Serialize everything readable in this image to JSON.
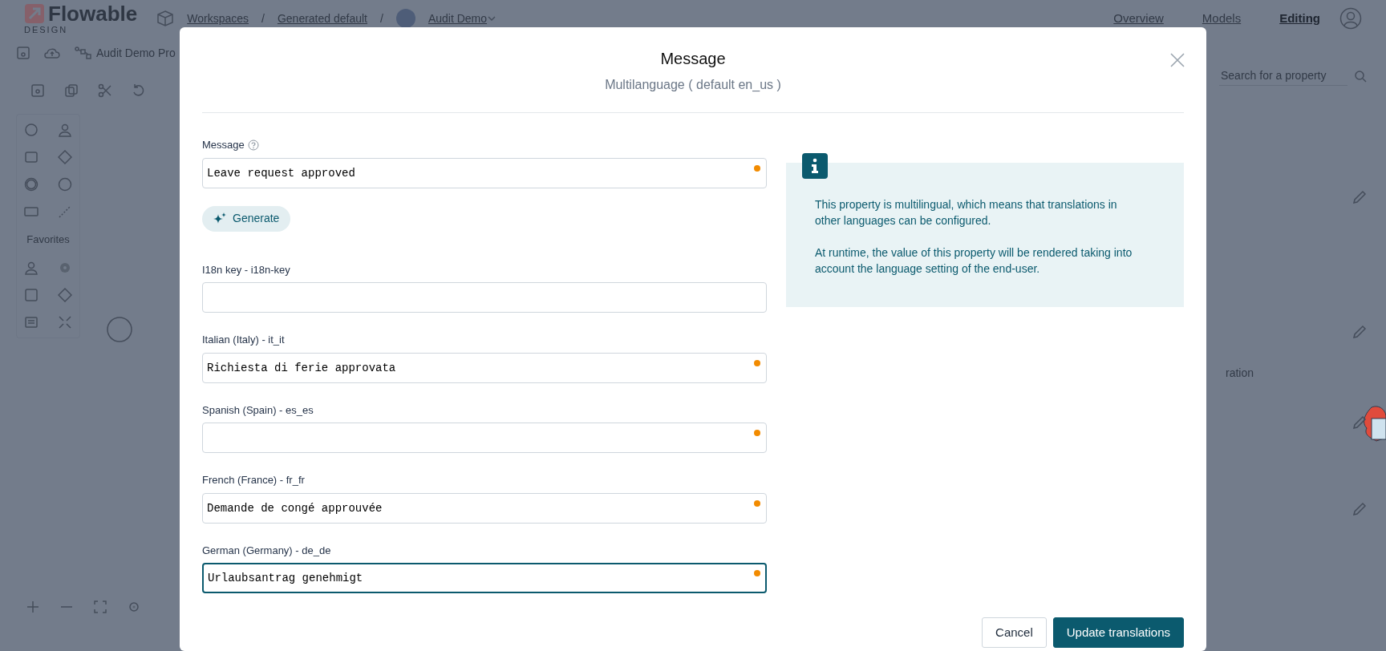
{
  "background": {
    "top_bar": {
      "logo": "Flowable",
      "logo_subtitle": "DESIGN",
      "breadcrumbs": [
        "Workspaces",
        "Generated default",
        "Audit Demo"
      ],
      "separators": [
        "/",
        "/"
      ],
      "nav": [
        {
          "label": "Overview",
          "selected": false
        },
        {
          "label": "Models",
          "selected": false
        },
        {
          "label": "Editing",
          "selected": true
        }
      ]
    },
    "toolbar": {
      "model_name": "Audit Demo Pro"
    },
    "palette": {
      "section": "Favorites"
    },
    "properties": {
      "search_placeholder": "Search for a property",
      "partial_label": "ration"
    }
  },
  "dialog": {
    "title": "Message",
    "subtitle": "Multilanguage ( default en_us )",
    "fields": [
      {
        "label": "Message",
        "help": true,
        "value": "Leave request approved",
        "modified": true,
        "focused": false
      },
      {
        "label": "I18n key - i18n-key",
        "help": false,
        "modified": false,
        "focused": false
      },
      {
        "label": "Italian (Italy) - it_it",
        "help": false,
        "value": "Richiesta di ferie approvata",
        "modified": true,
        "focused": false
      },
      {
        "label": "Spanish (Spain) - es_es",
        "help": false,
        "modified": true,
        "focused": false
      },
      {
        "label": "French (France) - fr_fr",
        "help": false,
        "value": "Demande de congé approuvée",
        "modified": true,
        "focused": false
      },
      {
        "label": "German (Germany) - de_de",
        "help": false,
        "value": "Urlaubsantrag genehmigt",
        "modified": true,
        "focused": true
      }
    ],
    "generate_button": "Generate",
    "info": [
      "This property is multilingual, which means that translations in other languages can be configured.",
      "At runtime, the value of this property will be rendered taking into account the language setting of the end-user."
    ],
    "buttons": [
      {
        "label": "Cancel",
        "kind": "secondary"
      },
      {
        "label": "Update translations",
        "kind": "primary"
      }
    ]
  }
}
